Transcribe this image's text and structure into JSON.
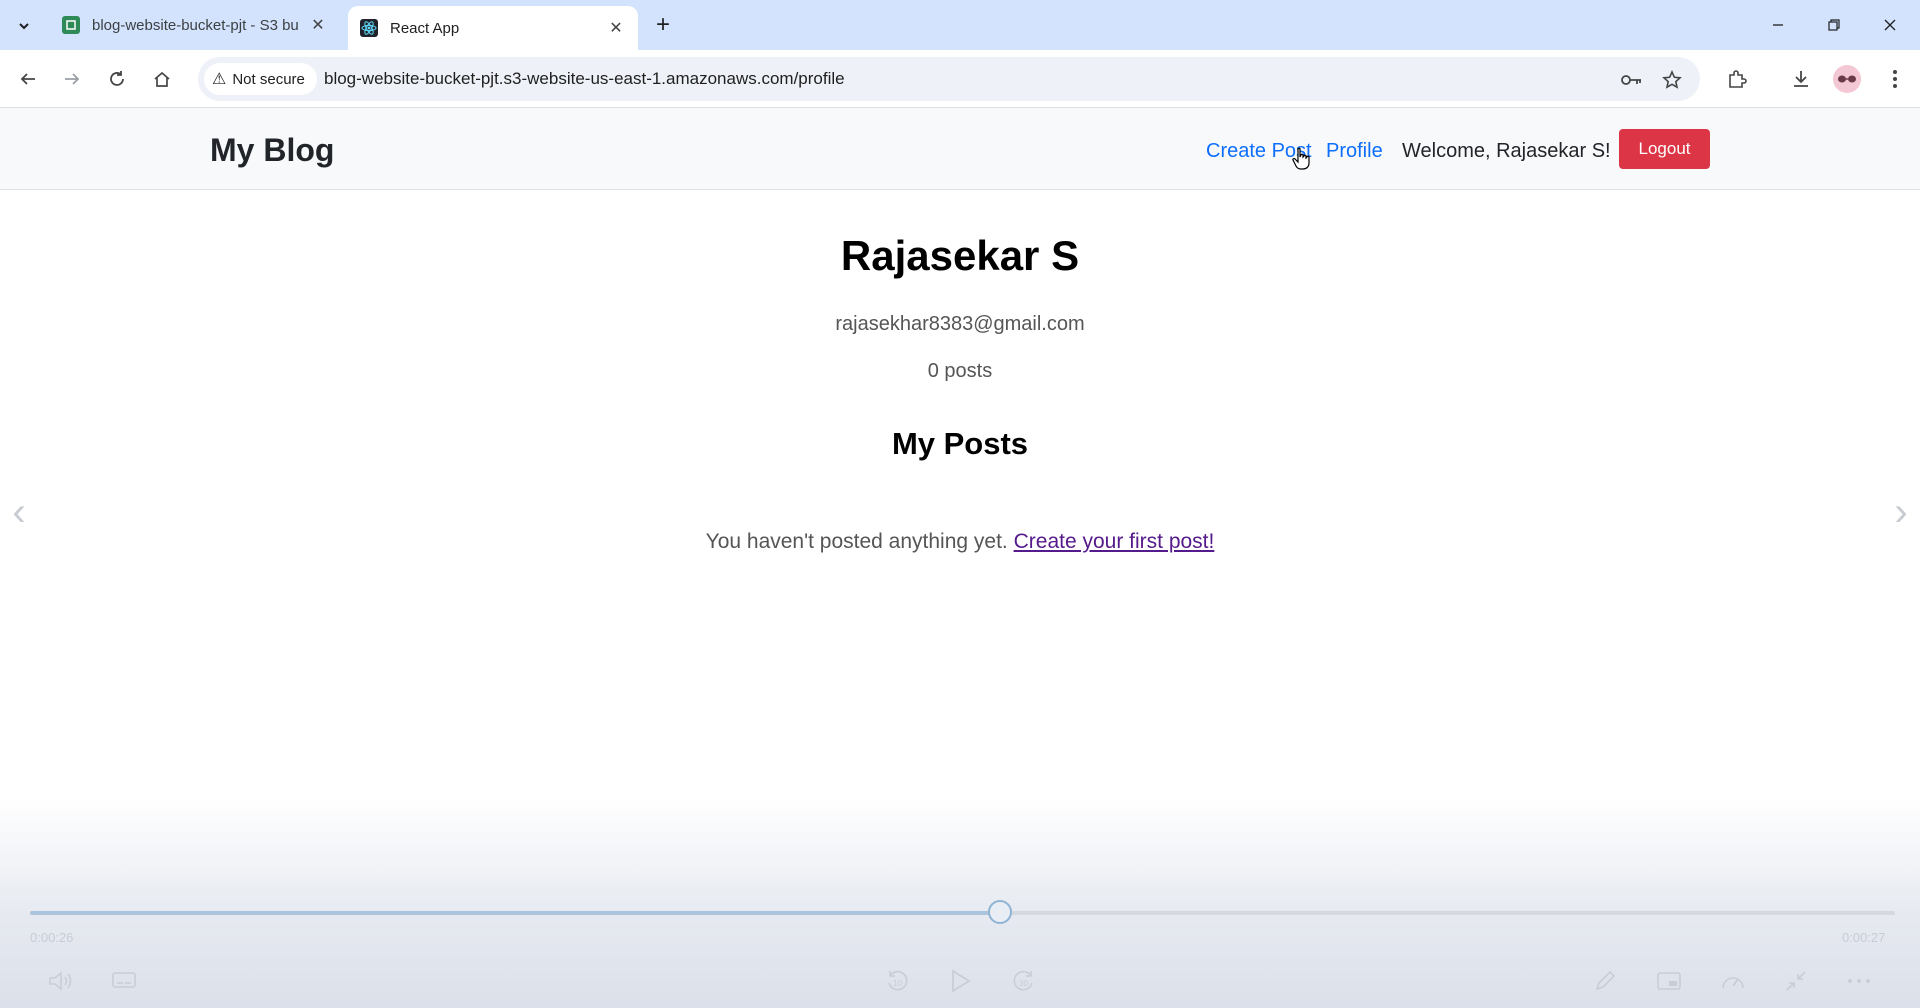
{
  "browser": {
    "tabs": [
      {
        "title": "blog-website-bucket-pjt - S3 bu",
        "favicon": "s3-bucket-icon"
      },
      {
        "title": "React App",
        "favicon": "react-icon"
      }
    ],
    "security_label": "Not secure",
    "url": "blog-website-bucket-pjt.s3-website-us-east-1.amazonaws.com/profile"
  },
  "site": {
    "brand": "My Blog",
    "nav": {
      "create_post": "Create Post",
      "profile": "Profile",
      "welcome": "Welcome, Rajasekar S!",
      "logout": "Logout"
    }
  },
  "profile": {
    "name": "Rajasekar S",
    "email": "rajasekhar8383@gmail.com",
    "post_count": "0 posts",
    "posts_heading": "My Posts",
    "empty_message": "You haven't posted anything yet.",
    "empty_link": "Create your first post!"
  },
  "player": {
    "elapsed": "0:00:26",
    "duration": "0:00:27",
    "progress": 0.52
  },
  "colors": {
    "tabstrip": "#d3e3fd",
    "link": "#0d6efd",
    "logout_bg": "#dc3545",
    "visited_link": "#551a8b"
  }
}
